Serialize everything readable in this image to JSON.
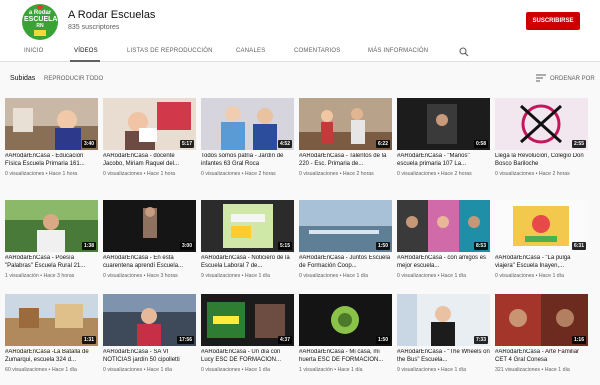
{
  "channel": {
    "name": "A Rodar Escuelas",
    "subscribers": "835 suscriptores",
    "subscribe_label": "SUSCRIBIRSE",
    "logo_text_top": "a Rodar",
    "logo_text_main": "ESCUELA",
    "logo_text_small": "RN"
  },
  "tabs": [
    {
      "label": "INICIO",
      "active": false
    },
    {
      "label": "VÍDEOS",
      "active": true
    },
    {
      "label": "LISTAS DE REPRODUCCIÓN",
      "active": false
    },
    {
      "label": "CANALES",
      "active": false
    },
    {
      "label": "COMENTARIOS",
      "active": false
    },
    {
      "label": "MÁS INFORMACIÓN",
      "active": false
    }
  ],
  "icons": {
    "search": "search-icon",
    "sort": "sort-icon"
  },
  "subbar": {
    "title": "Subidas",
    "play_all": "REPRODUCIR TODO",
    "sort_label": "ORDENAR POR"
  },
  "colors": {
    "subscribe": "#cc0000",
    "accent": "#606060"
  },
  "videos": [
    {
      "title": "#ARodarEnCasa - Educación Física Escuela Primaria 161...",
      "views": "0 visualizaciones",
      "age": "Hace 1 hora",
      "duration": "3:40",
      "thumb": "bg1"
    },
    {
      "title": "#ARodarEnCasa - docente Jacobo, Miriam Raquel del...",
      "views": "0 visualizaciones",
      "age": "Hace 1 hora",
      "duration": "5:17",
      "thumb": "bg2"
    },
    {
      "title": "Todos somos patria - Jardín de infantes 63 Gral Roca",
      "views": "0 visualizaciones",
      "age": "Hace 2 horas",
      "duration": "4:52",
      "thumb": "bg3"
    },
    {
      "title": "#ARodarEnCasa - Talentos de la 220 - Esc. Primaria de...",
      "views": "0 visualizaciones",
      "age": "Hace 2 horas",
      "duration": "6:22",
      "thumb": "bg4"
    },
    {
      "title": "#ARodarEnCasa - \"Manos\" escuela primaria 107 La...",
      "views": "0 visualizaciones",
      "age": "Hace 2 horas",
      "duration": "0:58",
      "thumb": "bg5"
    },
    {
      "title": "Llega la Revolución, Colegio Don Bosco Bariloche",
      "views": "0 visualizaciones",
      "age": "Hace 2 horas",
      "duration": "2:55",
      "thumb": "bg6"
    },
    {
      "title": "#ARodarEnCasa - Poesía \"Palabras\" Escuela Rural 21...",
      "views": "1 visualización",
      "age": "Hace 3 horas",
      "duration": "1:38",
      "thumb": "bg7"
    },
    {
      "title": "#ARodarEnCasa - En esta cuarentena aprendí Escuela...",
      "views": "0 visualizaciones",
      "age": "Hace 3 horas",
      "duration": "3:00",
      "thumb": "bg8"
    },
    {
      "title": "#ARodarEnCasa - Noticiero de la Escuela Laboral 7 de...",
      "views": "9 visualizaciones",
      "age": "Hace 1 día",
      "duration": "5:15",
      "thumb": "bg9"
    },
    {
      "title": "#ARodarEnCasa - Juntos Escuela de Formación Coop...",
      "views": "0 visualizaciones",
      "age": "Hace 1 día",
      "duration": "1:50",
      "thumb": "bg10"
    },
    {
      "title": "#ARodarEnCasa - con amigos es mejor escuela...",
      "views": "0 visualizaciones",
      "age": "Hace 1 día",
      "duration": "8:53",
      "thumb": "bg11"
    },
    {
      "title": "#ARodarEnCasa - \"La pulga viajera\" Escuela Inayen,...",
      "views": "0 visualizaciones",
      "age": "Hace 1 día",
      "duration": "6:31",
      "thumb": "bg12"
    },
    {
      "title": "#ARodarEnCasa -La Batalla de Zumarqui, escuela 324 d...",
      "views": "60 visualizaciones",
      "age": "Hace 1 día",
      "duration": "1:31",
      "thumb": "bg13"
    },
    {
      "title": "#ARodarEnCasa - SA VI NOTICIAS jardín 50 cipolletti",
      "views": "0 visualizaciones",
      "age": "Hace 1 día",
      "duration": "17:56",
      "thumb": "bg14"
    },
    {
      "title": "#ARodarEnCasa - Un día con Lucy ESC DE FORMACION...",
      "views": "0 visualizaciones",
      "age": "Hace 1 día",
      "duration": "4:37",
      "thumb": "bg15"
    },
    {
      "title": "#ARodarEnCasa - Mi casa, mi huerta ESC DE FORMACION...",
      "views": "1 visualización",
      "age": "Hace 1 día",
      "duration": "1:50",
      "thumb": "bg16"
    },
    {
      "title": "#ARodarEnCasa - \"The Wheels on the Bus\" Escuela...",
      "views": "9 visualizaciones",
      "age": "Hace 1 día",
      "duration": "7:33",
      "thumb": "bg17"
    },
    {
      "title": "#ARodarEnCasa - Arte Familiar CET 4 Gral Conesa",
      "views": "321 visualizaciones",
      "age": "Hace 1 día",
      "duration": "1:16",
      "thumb": "bg18"
    }
  ]
}
